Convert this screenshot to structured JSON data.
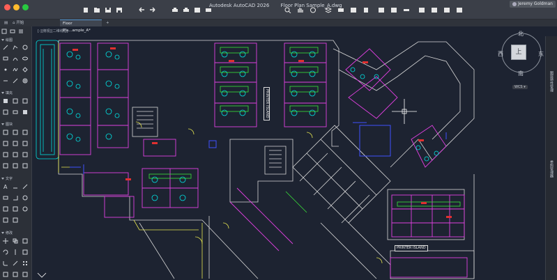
{
  "window": {
    "app_title": "Autodesk AutoCAD 2026",
    "file_title": "Floor Plan Sample_A.dwg",
    "user": "Jeremy Goldman"
  },
  "tabs": [
    {
      "label": "开始",
      "active": false
    },
    {
      "label": "Floor Pla...ample_A*",
      "active": true
    }
  ],
  "viewport": {
    "label": "[-]俯视][二维线框]",
    "crumb": "俯视",
    "style": "二维线框"
  },
  "left_panel": {
    "sections": [
      {
        "title": "绘图"
      },
      {
        "title": "填充"
      },
      {
        "title": "图块"
      },
      {
        "title": "文字"
      },
      {
        "title": "修改"
      }
    ]
  },
  "right_panel": {
    "items": [
      "图层特性管理",
      "参照管理器"
    ]
  },
  "compass": {
    "north": "北",
    "south": "南",
    "east": "东",
    "west": "西",
    "cube_face": "上",
    "wcs": "WCS"
  },
  "drawing_labels": {
    "printer_island_vertical": "PRINTER ISLAND",
    "printer_island_horizontal": "PRINTER ISLAND"
  },
  "colors": {
    "walls": "#d8d8d8",
    "furniture": "#00e5e5",
    "rooms": "#e040e0",
    "doors": "#e6e650",
    "green": "#39e639",
    "blue": "#4050ff",
    "background": "#1d2331"
  }
}
